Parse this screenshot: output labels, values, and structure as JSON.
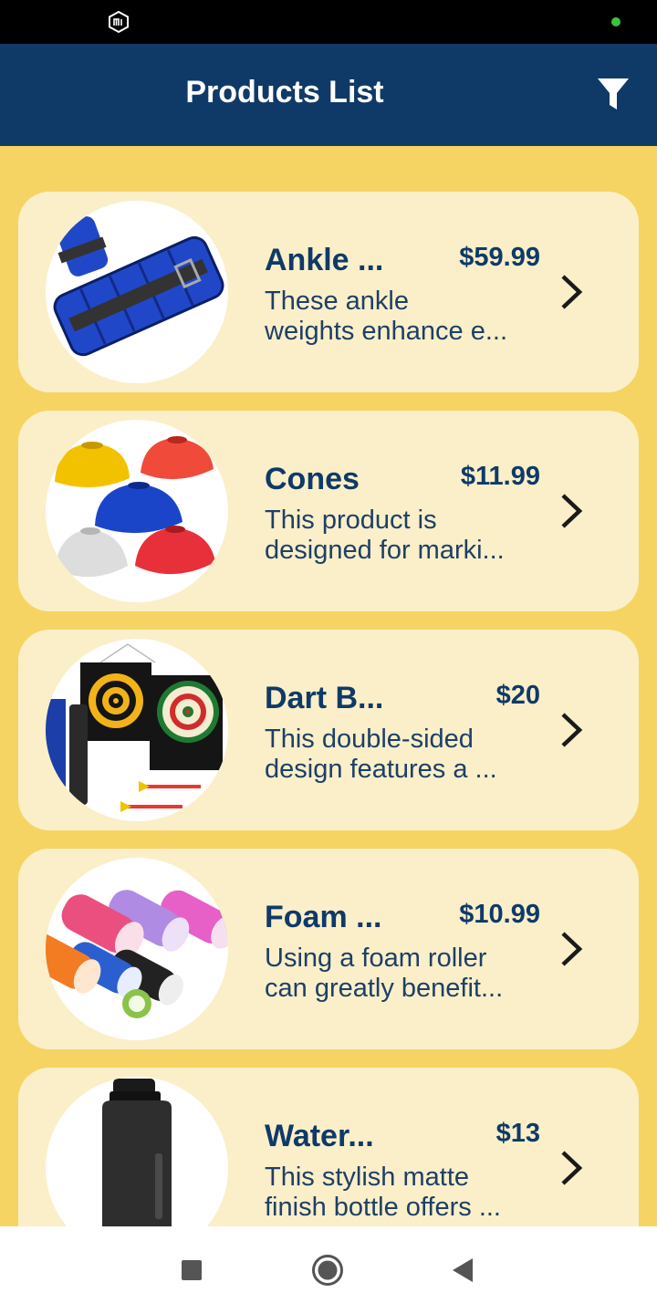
{
  "app_bar": {
    "title": "Products List",
    "filter_icon": "filter-icon",
    "color": "#0f3a68"
  },
  "products": [
    {
      "name": "Ankle ...",
      "price": "$59.99",
      "desc_line1": " These ankle",
      "desc_line2": "weights enhance e...",
      "image": "ankle-weights-image"
    },
    {
      "name": "Cones",
      "price": "$11.99",
      "desc_line1": " This product is",
      "desc_line2": "designed for marki...",
      "image": "cones-image"
    },
    {
      "name": "Dart B...",
      "price": "$20",
      "desc_line1": "This double-sided",
      "desc_line2": "design features a ...",
      "image": "dart-board-image"
    },
    {
      "name": "Foam ...",
      "price": "$10.99",
      "desc_line1": "Using a foam roller",
      "desc_line2": "can greatly benefit...",
      "image": "foam-roller-image"
    },
    {
      "name": "Water...",
      "price": "$13",
      "desc_line1": "This stylish matte",
      "desc_line2": "finish bottle offers ...",
      "image": "water-bottle-image"
    }
  ],
  "colors": {
    "background": "#f5d463",
    "card": "#faefc8",
    "text": "#0f3a68"
  },
  "nav": {
    "icons": [
      "recents-icon",
      "home-icon",
      "back-icon"
    ]
  }
}
